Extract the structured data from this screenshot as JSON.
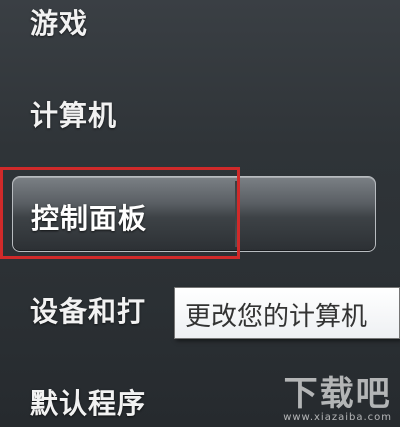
{
  "start_menu": {
    "items": [
      {
        "label": "游戏"
      },
      {
        "label": "计算机"
      },
      {
        "label": "控制面板"
      },
      {
        "label": "设备和打"
      },
      {
        "label": "默认程序"
      }
    ],
    "highlighted_index": 2
  },
  "tooltip": {
    "text": "更改您的计算机"
  },
  "watermark": {
    "main": "下载吧",
    "sub": "www.xiazaiba.com"
  },
  "colors": {
    "highlight_outline": "#d02a2a",
    "menu_text": "#f2f2f2",
    "panel_bg": "#2f3438"
  }
}
